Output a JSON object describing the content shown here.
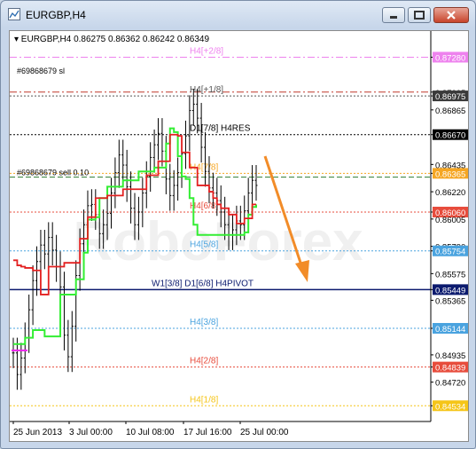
{
  "window": {
    "title": "EURGBP,H4",
    "buttons": [
      "minimize",
      "restore",
      "close"
    ]
  },
  "chart_data": {
    "type": "line",
    "symbol_header": "EURGBP,H4  0.86275 0.86362 0.86242 0.86349",
    "ylim": [
      0.8441,
      0.8743
    ],
    "price_ticks": [
      "0.87280",
      "0.87005",
      "0.86975",
      "0.86865",
      "0.86670",
      "0.86435",
      "0.86365",
      "0.86220",
      "0.86060",
      "0.86005",
      "0.85790",
      "0.85754",
      "0.85575",
      "0.85449",
      "0.85365",
      "0.85144",
      "0.84935",
      "0.84839",
      "0.84720",
      "0.84534"
    ],
    "highlight_ticks": [
      {
        "label": "0.87280",
        "color": "#ee82ee"
      },
      {
        "label": "0.86975",
        "color": "#3a3a3a"
      },
      {
        "label": "0.86670",
        "color": "#000000"
      },
      {
        "label": "0.86365",
        "color": "#f5a623"
      },
      {
        "label": "0.86060",
        "color": "#e74c3c"
      },
      {
        "label": "0.85754",
        "color": "#4aa3df"
      },
      {
        "label": "0.85449",
        "color": "#0b1a6e"
      },
      {
        "label": "0.85144",
        "color": "#4aa3df"
      },
      {
        "label": "0.84839",
        "color": "#e74c3c"
      },
      {
        "label": "0.84534",
        "color": "#f5c518"
      }
    ],
    "x_ticks": [
      "25 Jun 2013",
      "3 Jul 00:00",
      "10 Jul 08:00",
      "17 Jul 16:00",
      "25 Jul 00:00"
    ],
    "levels": [
      {
        "price": 0.8728,
        "label": "H4[+2/8]",
        "color": "#ee82ee",
        "style": "dash-dot"
      },
      {
        "price": 0.87005,
        "label": "",
        "color": "#c0392b",
        "style": "dash-dot"
      },
      {
        "price": 0.86975,
        "label": "H4[+1/8]",
        "color": "#555555",
        "style": "dotted"
      },
      {
        "price": 0.8667,
        "label": "D1[7/8] H4RES",
        "color": "#000000",
        "style": "dotted"
      },
      {
        "price": 0.86365,
        "label": "H4[7/8]",
        "color": "#f5a623",
        "style": "dotted"
      },
      {
        "price": 0.86335,
        "label": "",
        "color": "#2e7d32",
        "style": "dashed"
      },
      {
        "price": 0.8606,
        "label": "H4[6/8]",
        "color": "#e74c3c",
        "style": "dotted"
      },
      {
        "price": 0.85754,
        "label": "H4[5/8]",
        "color": "#4aa3df",
        "style": "dotted"
      },
      {
        "price": 0.85449,
        "label": "W1[3/8] D1[6/8] H4PIVOT",
        "color": "#0b1a6e",
        "style": "solid"
      },
      {
        "price": 0.85144,
        "label": "H4[3/8]",
        "color": "#4aa3df",
        "style": "dotted"
      },
      {
        "price": 0.84839,
        "label": "H4[2/8]",
        "color": "#e74c3c",
        "style": "dotted"
      },
      {
        "price": 0.84534,
        "label": "H4[1/8]",
        "color": "#f5c518",
        "style": "dotted"
      }
    ],
    "order_labels": [
      "#69868679 sl",
      "#69868679 sell 0.10"
    ],
    "watermark": "RoboForex",
    "price_series": [
      0.8495,
      0.8478,
      0.8491,
      0.8507,
      0.8529,
      0.8552,
      0.8567,
      0.858,
      0.8573,
      0.8586,
      0.8576,
      0.8563,
      0.8547,
      0.8509,
      0.8492,
      0.8516,
      0.8556,
      0.8581,
      0.8596,
      0.8611,
      0.8612,
      0.8604,
      0.8589,
      0.8596,
      0.8605,
      0.8621,
      0.8637,
      0.8651,
      0.8643,
      0.8626,
      0.8609,
      0.8596,
      0.8606,
      0.8621,
      0.8634,
      0.8649,
      0.8659,
      0.8668,
      0.8654,
      0.8632,
      0.8619,
      0.8627,
      0.8637,
      0.8652,
      0.8666,
      0.8686,
      0.8691,
      0.868,
      0.8657,
      0.8638,
      0.8625,
      0.8621,
      0.8615,
      0.8606,
      0.8596,
      0.8588,
      0.8592,
      0.8599,
      0.8596,
      0.8607,
      0.8621,
      0.8631,
      0.8627
    ],
    "trail_red": [
      0.8568,
      0.8564,
      0.8563,
      0.8562,
      0.8562,
      0.856,
      0.856,
      0.8541,
      0.8541,
      0.8563,
      0.8563,
      0.8563,
      0.8563,
      0.8566,
      0.8566,
      0.8566,
      0.8566,
      0.8585,
      0.8585,
      0.8602,
      0.8602,
      0.8617,
      0.8617,
      0.8617,
      0.8619,
      0.8619,
      0.8619,
      0.8619,
      0.8624,
      0.8624,
      0.8624,
      0.8624,
      0.8624,
      0.8624,
      0.8635,
      0.8635,
      0.8635,
      0.8646,
      0.8646,
      0.8646,
      0.8667,
      0.8667,
      0.8666,
      0.8653,
      0.8653,
      0.8641,
      0.8641,
      0.8627,
      0.8627,
      0.8627,
      0.8622,
      0.8617,
      0.8612,
      0.8609,
      0.8609,
      0.8604,
      0.8604,
      0.8597,
      0.8597,
      0.8601,
      0.8601,
      0.8612,
      0.8612
    ],
    "trail_green": [
      0.8502,
      0.8502,
      0.8502,
      0.8507,
      0.8507,
      0.8513,
      0.8513,
      0.8513,
      0.8508,
      0.8508,
      0.8508,
      0.8508,
      0.8541,
      0.8541,
      0.8541,
      0.8541,
      0.8553,
      0.8553,
      0.8574,
      0.86,
      0.86,
      0.8602,
      0.8617,
      0.8617,
      0.8626,
      0.8626,
      0.8626,
      0.8626,
      0.8631,
      0.8631,
      0.8631,
      0.8631,
      0.8638,
      0.8638,
      0.8638,
      0.8638,
      0.8641,
      0.8641,
      0.8641,
      0.866,
      0.8672,
      0.8669,
      0.865,
      0.8634,
      0.8632,
      0.8617,
      0.8596,
      0.8588,
      0.8588,
      0.8588,
      0.8588,
      0.8588,
      0.8588,
      0.8588,
      0.8588,
      0.8588,
      0.8588,
      0.8588,
      0.8588,
      0.859,
      0.8604,
      0.861,
      0.8612
    ]
  }
}
